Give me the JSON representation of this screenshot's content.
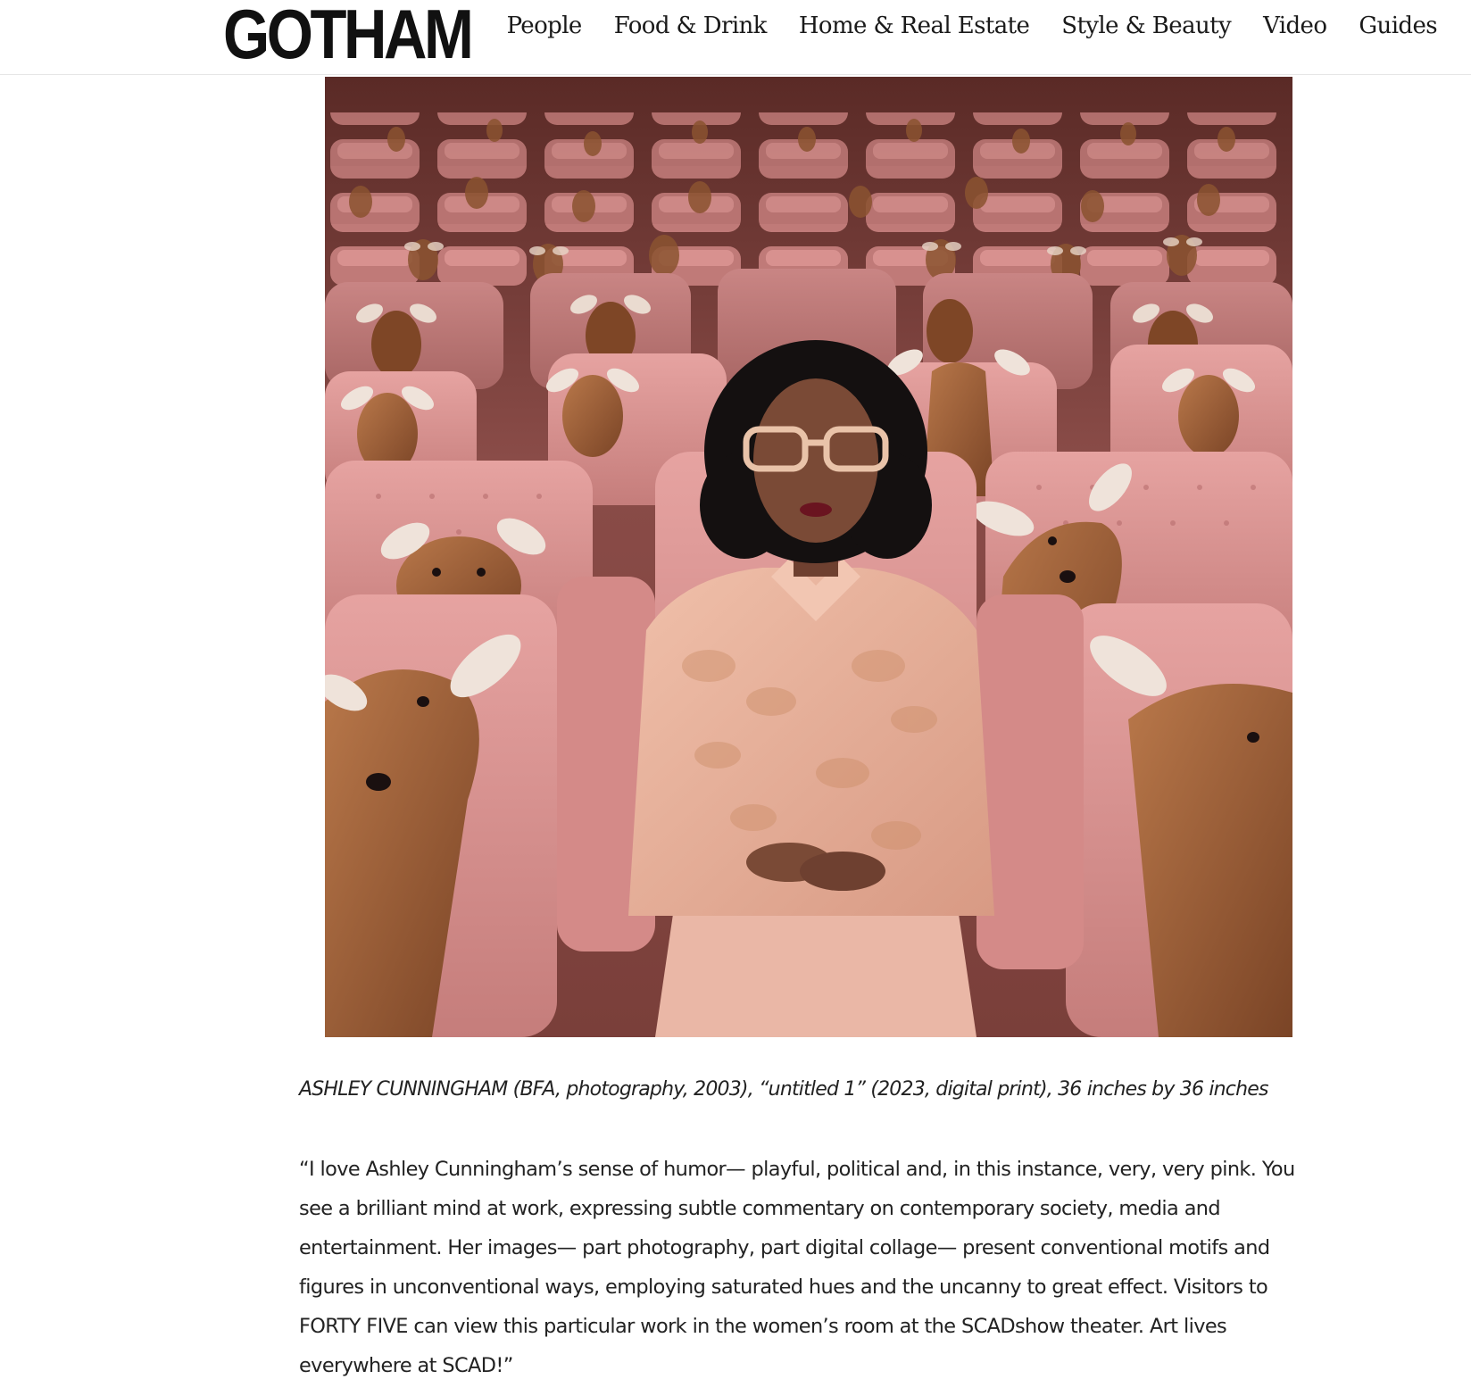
{
  "site": {
    "logo": "GOTHAM"
  },
  "nav": {
    "items": [
      "People",
      "Food & Drink",
      "Home & Real Estate",
      "Style & Beauty",
      "Video",
      "Guides"
    ]
  },
  "artwork": {
    "caption": "ASHLEY CUNNINGHAM (BFA, photography, 2003), “untitled 1” (2023, digital print), 36 inches by 36 inches"
  },
  "article": {
    "quote_lines": [
      "“I love Ashley Cunningham’s sense of humor— playful, political and, in this instance, very, very pink. You",
      "see a brilliant mind at work, expressing subtle commentary on contemporary society, media and",
      "entertainment. Her images— part photography, part digital collage— present conventional motifs and",
      "figures in unconventional ways, employing saturated hues and the uncanny to great effect. Visitors to",
      "FORTY FIVE can view this particular work in the women’s room at the SCADshow theater. Art lives",
      "everywhere at SCAD!”"
    ]
  },
  "colors": {
    "seat_pink": "#d98f8f",
    "seat_shadow": "#b86e6e",
    "deer_brown": "#9a5a34",
    "blouse": "#e8b49e",
    "hair": "#141010",
    "background": "#5a2f2a"
  }
}
